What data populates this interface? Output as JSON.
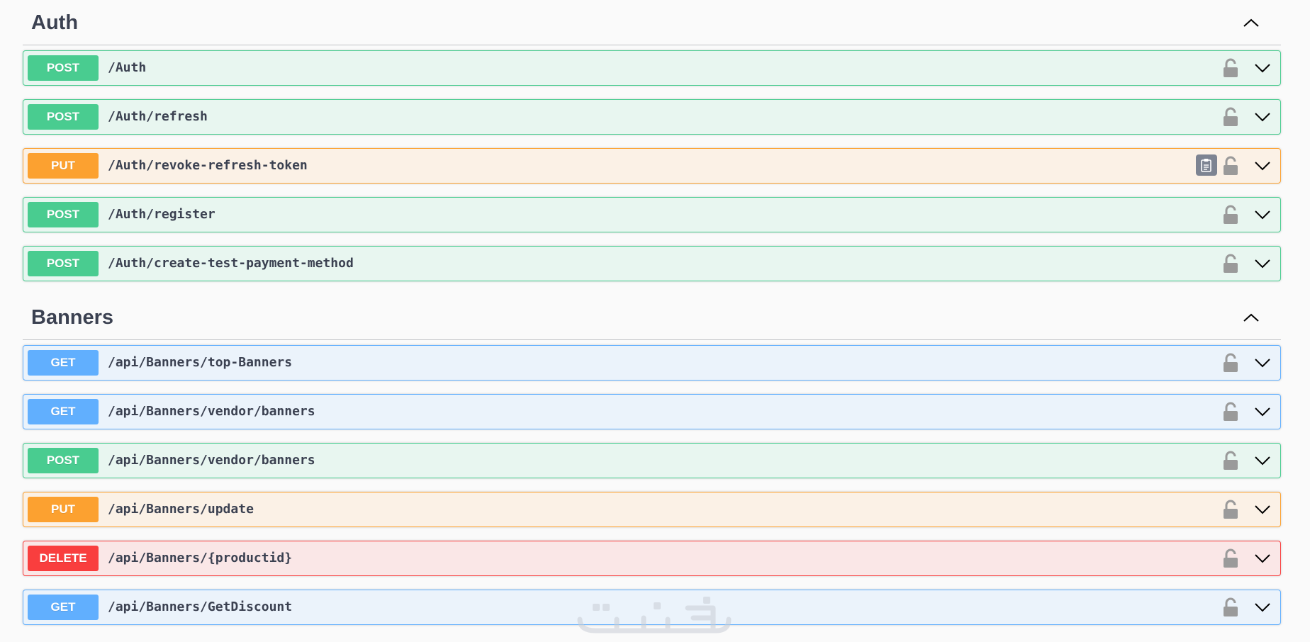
{
  "sections": [
    {
      "title": "Auth",
      "operations": [
        {
          "method": "POST",
          "path": "/Auth"
        },
        {
          "method": "POST",
          "path": "/Auth/refresh"
        },
        {
          "method": "PUT",
          "path": "/Auth/revoke-refresh-token",
          "copy_button": true
        },
        {
          "method": "POST",
          "path": "/Auth/register"
        },
        {
          "method": "POST",
          "path": "/Auth/create-test-payment-method"
        }
      ]
    },
    {
      "title": "Banners",
      "operations": [
        {
          "method": "GET",
          "path": "/api/Banners/top-Banners"
        },
        {
          "method": "GET",
          "path": "/api/Banners/vendor/banners"
        },
        {
          "method": "POST",
          "path": "/api/Banners/vendor/banners"
        },
        {
          "method": "PUT",
          "path": "/api/Banners/update"
        },
        {
          "method": "DELETE",
          "path": "/api/Banners/{productid}"
        },
        {
          "method": "GET",
          "path": "/api/Banners/GetDiscount"
        }
      ]
    }
  ],
  "watermark": "خمسات",
  "colors": {
    "post": "#49cc90",
    "put": "#fca130",
    "get": "#61affe",
    "delete": "#f93e3e",
    "text": "#3b4151"
  },
  "icons": {
    "section_toggle": "chevron-up-icon",
    "operation_expand": "chevron-down-icon",
    "authorization": "unlocked-padlock-icon",
    "copy": "clipboard-copy-icon"
  }
}
